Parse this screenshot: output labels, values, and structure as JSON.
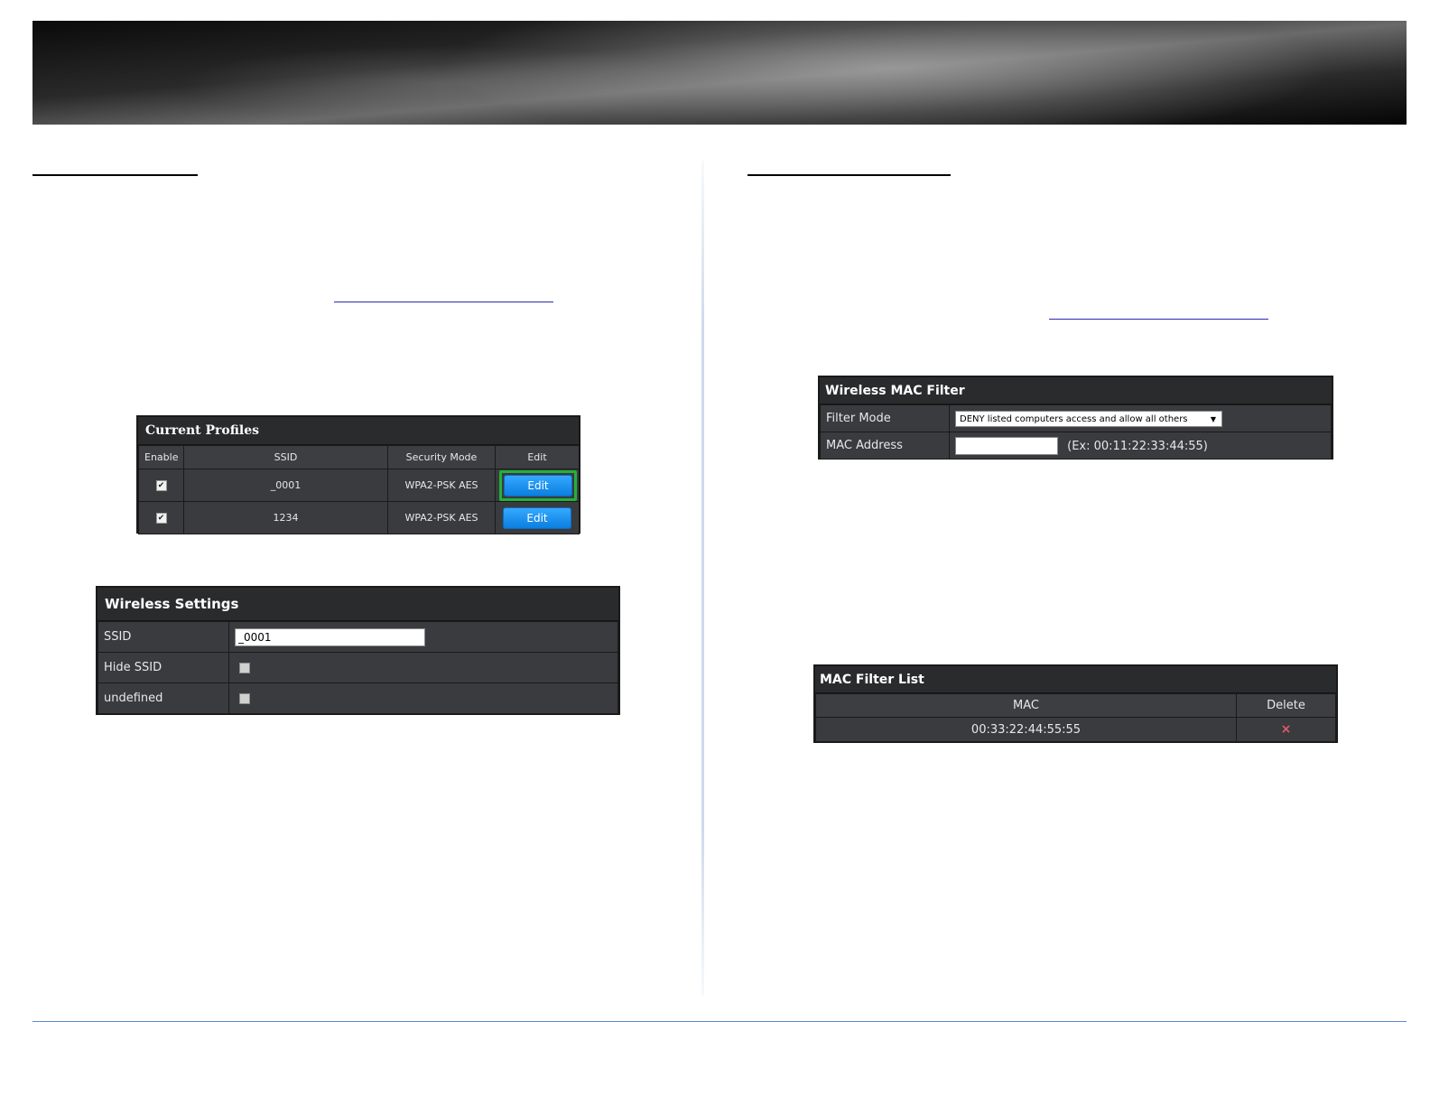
{
  "current_profiles": {
    "title": "Current Profiles",
    "columns": [
      "Enable",
      "SSID",
      "Security Mode",
      "Edit"
    ],
    "rows": [
      {
        "enabled": true,
        "ssid": "_0001",
        "security": "WPA2-PSK AES",
        "edit": "Edit",
        "highlighted": true
      },
      {
        "enabled": true,
        "ssid": "1234",
        "security": "WPA2-PSK AES",
        "edit": "Edit",
        "highlighted": false
      }
    ]
  },
  "wireless_settings": {
    "title": "Wireless Settings",
    "ssid_label": "SSID",
    "ssid_value": "_0001",
    "hide_ssid_label": "Hide SSID",
    "undefined_label": "undefined"
  },
  "mac_filter": {
    "title": "Wireless MAC Filter",
    "filter_mode_label": "Filter Mode",
    "filter_mode_value": "DENY listed computers access and allow all others",
    "mac_address_label": "MAC Address",
    "mac_address_value": "",
    "mac_address_hint": "(Ex: 00:11:22:33:44:55)"
  },
  "mac_list": {
    "title": "MAC Filter List",
    "columns": [
      "MAC",
      "Delete"
    ],
    "rows": [
      {
        "mac": "00:33:22:44:55:55",
        "delete_icon": "×"
      }
    ]
  },
  "colors": {
    "panel_bg": "#2f3033",
    "edit_button": "#0a7fe0",
    "highlight_border": "#21b23a",
    "delete_icon": "#e05a68",
    "footer_line": "#5a8fc7"
  }
}
